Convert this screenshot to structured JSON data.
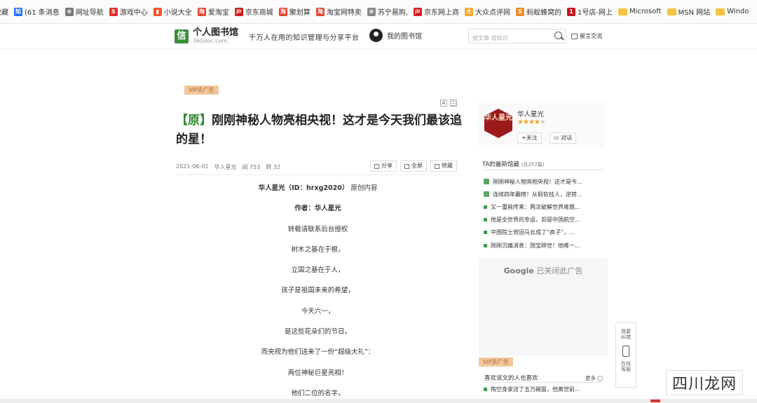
{
  "bookmarks": [
    {
      "label": "收藏",
      "icon": "none",
      "color": ""
    },
    {
      "label": "(61 条消息",
      "icon": "zhihu-icon",
      "color": "#1e6fff",
      "glyph": "知"
    },
    {
      "label": "网址导航",
      "icon": "globe-icon",
      "color": "#777",
      "glyph": "⊕"
    },
    {
      "label": "游戏中心",
      "icon": "weibo-icon",
      "color": "#e0312b",
      "glyph": "S"
    },
    {
      "label": "小说大全",
      "icon": "reader-icon",
      "color": "#f0552d",
      "glyph": "▮"
    },
    {
      "label": "爱淘宝",
      "icon": "taobao-icon",
      "color": "#e8412c",
      "glyph": "淘"
    },
    {
      "label": "京东商城",
      "icon": "jd-icon",
      "color": "#d11f1f",
      "glyph": "JD"
    },
    {
      "label": "聚划算",
      "icon": "taobao-icon",
      "color": "#e8412c",
      "glyph": "淘"
    },
    {
      "label": "淘宝网特卖",
      "icon": "taobao-icon",
      "color": "#e8412c",
      "glyph": "淘"
    },
    {
      "label": "苏宁易购,",
      "icon": "document-icon",
      "color": "#888",
      "glyph": "≡"
    },
    {
      "label": "京东网上商",
      "icon": "jd-icon",
      "color": "#d11f1f",
      "glyph": "JD"
    },
    {
      "label": "大众点评网",
      "icon": "dianping-icon",
      "color": "#f5a623",
      "glyph": "大"
    },
    {
      "label": "蚂蚁蜂窝的",
      "icon": "mafengwo-icon",
      "color": "#f08c1f",
      "glyph": "S"
    },
    {
      "label": "1号店-网上",
      "icon": "yhd-icon",
      "color": "#c4161c",
      "glyph": "1"
    },
    {
      "label": "Microsoft",
      "icon": "folder-icon",
      "color": "#f4c542"
    },
    {
      "label": "MSN 网站",
      "icon": "folder-icon",
      "color": "#f4c542"
    },
    {
      "label": "Windo",
      "icon": "folder-icon",
      "color": "#f4c542"
    }
  ],
  "header": {
    "logo_glyph": "信",
    "site_name": "个人图书馆",
    "site_domain": "360doc.com",
    "slogan": "千万人在用的知识管理与分享平台",
    "my_library": "我的图书馆",
    "search_placeholder": "搜文章 找知识",
    "message": "留言交流"
  },
  "article": {
    "vip_tag": "VIP去广告",
    "font_ctrl": "A",
    "title_prefix": "【原】",
    "title": "刚刚神秘人物亮相央视！这才是今天我们最该追的星！",
    "date": "2021-06-01",
    "author": "华人星光",
    "reads": "阅 753",
    "reposts": "转 32",
    "actions": {
      "share": "分享",
      "fullscreen": "全屏",
      "save": "转藏"
    },
    "paragraphs": [
      {
        "text": "华人星光（ID：hrxg2020）原创内容",
        "bold": false,
        "boldpart": "华人星光（ID：hrxg2020）",
        "rest": "原创内容"
      },
      {
        "text": "作者：华人星光",
        "bold": true
      },
      {
        "text": "转载请联系后台授权",
        "bold": false
      },
      {
        "text": "树木之基在于根，",
        "bold": false
      },
      {
        "text": "立国之基在于人，",
        "bold": false
      },
      {
        "text": "孩子是祖国未来的希望，",
        "bold": false
      },
      {
        "text": "今天六一，",
        "bold": false
      },
      {
        "text": "是这些花朵们的节日。",
        "bold": false
      },
      {
        "text": "而央视为他们送来了一份“超级大礼”：",
        "bold": false
      },
      {
        "text": "两位神秘巨星亮相！",
        "bold": false
      },
      {
        "text": "他们二位的名字，",
        "bold": false
      }
    ]
  },
  "sidebar": {
    "author_card": {
      "avatar_text": "华人星光",
      "name": "华人星光",
      "rating": 4,
      "rating_max": 5,
      "follow": "+关注",
      "chat": "对话"
    },
    "latest": {
      "title": "TA的最新馆藏",
      "count": "(共257篇)",
      "items": [
        {
          "text": "刚刚神秘人物亮相央视！这才是今...",
          "type": "icon"
        },
        {
          "text": "连续四年霸榜！从假软技人，逆转...",
          "type": "icon"
        },
        {
          "text": "又一重耗传来：两次破解世界难题...",
          "type": "square"
        },
        {
          "text": "他是全世界的幸运，却是中国航空...",
          "type": "square"
        },
        {
          "text": "中国院士背因马云成了“疯子”，...",
          "type": "square"
        },
        {
          "text": "刚刚沉痛消息：国宝辞世！他唯一...",
          "type": "square"
        }
      ]
    },
    "ad": {
      "google": "Google",
      "closed": "已关闭此广告"
    },
    "vip_tag": "VIP去广告",
    "guess": {
      "title": "喜欢该文的人也喜欢",
      "more": "更多",
      "item": "掏空身家送了五万碗面，他离世前..."
    }
  },
  "float_tool": {
    "top": "我要纠错",
    "bottom": "在线客服"
  },
  "watermark": "四川龙网"
}
